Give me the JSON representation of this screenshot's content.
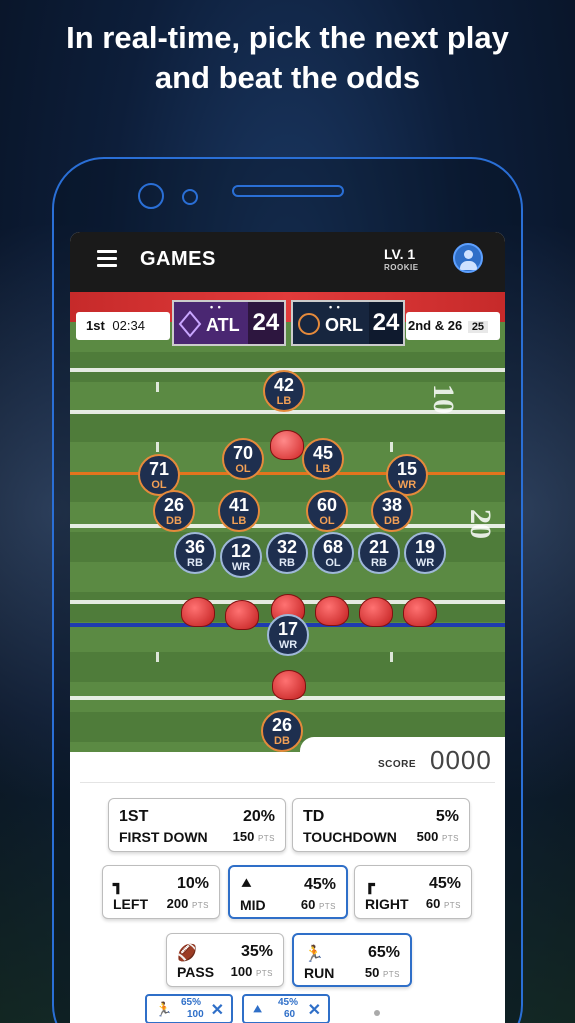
{
  "headline": {
    "line1": "In real-time, pick the next play",
    "line2": "and beat the odds"
  },
  "header": {
    "title": "GAMES",
    "level": "LV. 1",
    "rank": "ROOKIE",
    "menu_icon": "hamburger-menu-icon",
    "avatar_icon": "user-avatar-icon"
  },
  "scoreboard": {
    "quarter": "1st",
    "clock": "02:34",
    "home": {
      "abbr": "ATL",
      "score": "24",
      "color": "#4a2772"
    },
    "away": {
      "abbr": "ORL",
      "score": "24",
      "color": "#17263f"
    },
    "down": "2nd & 26",
    "yard_line": "25"
  },
  "field": {
    "yard_numbers": [
      "10",
      "20"
    ],
    "defense": [
      {
        "num": "42",
        "pos": "LB"
      },
      {
        "num": "70",
        "pos": "OL"
      },
      {
        "num": "45",
        "pos": "LB"
      },
      {
        "num": "71",
        "pos": "OL"
      },
      {
        "num": "15",
        "pos": "WR"
      },
      {
        "num": "26",
        "pos": "DB"
      },
      {
        "num": "41",
        "pos": "LB"
      },
      {
        "num": "60",
        "pos": "OL"
      },
      {
        "num": "38",
        "pos": "DB"
      }
    ],
    "offense": [
      {
        "num": "36",
        "pos": "RB"
      },
      {
        "num": "12",
        "pos": "WR"
      },
      {
        "num": "32",
        "pos": "RB"
      },
      {
        "num": "68",
        "pos": "OL"
      },
      {
        "num": "21",
        "pos": "RB"
      },
      {
        "num": "19",
        "pos": "WR"
      },
      {
        "num": "17",
        "pos": "WR"
      },
      {
        "num": "26",
        "pos": "DB"
      }
    ]
  },
  "score": {
    "label": "SCORE",
    "value": "0000"
  },
  "picks": {
    "first_down": {
      "icon": "1ST",
      "label": "FIRST DOWN",
      "pct": "20%",
      "pts": "150",
      "unit": "PTS"
    },
    "touchdown": {
      "icon": "TD",
      "label": "TOUCHDOWN",
      "pct": "5%",
      "pts": "500",
      "unit": "PTS"
    },
    "left": {
      "icon": "left-turn-icon",
      "label": "LEFT",
      "pct": "10%",
      "pts": "200",
      "unit": "PTS"
    },
    "mid": {
      "icon": "up-chevron-icon",
      "label": "MID",
      "pct": "45%",
      "pts": "60",
      "unit": "PTS",
      "selected": true
    },
    "right": {
      "icon": "right-turn-icon",
      "label": "RIGHT",
      "pct": "45%",
      "pts": "60",
      "unit": "PTS"
    },
    "pass": {
      "icon": "pass-icon",
      "label": "PASS",
      "pct": "35%",
      "pts": "100",
      "unit": "PTS"
    },
    "run": {
      "icon": "run-icon",
      "label": "RUN",
      "pct": "65%",
      "pts": "50",
      "unit": "PTS",
      "selected": true
    }
  },
  "selected_chips": [
    {
      "icon": "run-icon",
      "pct": "65%",
      "pts": "100"
    },
    {
      "icon": "up-chevron-icon",
      "pct": "45%",
      "pts": "60"
    }
  ],
  "accent": "#2f6fc8"
}
